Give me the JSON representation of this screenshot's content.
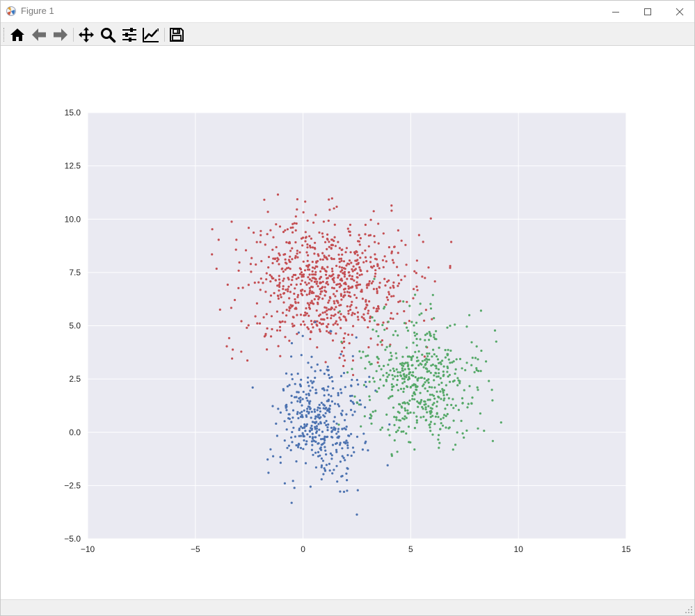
{
  "window": {
    "title": "Figure 1"
  },
  "titlebar_buttons": {
    "minimize_icon": "minimize-icon",
    "maximize_icon": "maximize-icon",
    "close_icon": "close-icon"
  },
  "toolbar": {
    "items": [
      {
        "id": "home",
        "icon": "home-icon"
      },
      {
        "id": "back",
        "icon": "arrow-left-icon"
      },
      {
        "id": "forward",
        "icon": "arrow-right-icon"
      },
      {
        "id": "pan",
        "icon": "move-icon"
      },
      {
        "id": "zoom",
        "icon": "magnifier-icon"
      },
      {
        "id": "subplots",
        "icon": "sliders-icon"
      },
      {
        "id": "edit",
        "icon": "line-chart-icon"
      },
      {
        "id": "save",
        "icon": "floppy-disk-icon"
      }
    ]
  },
  "statusbar": {
    "text": ""
  },
  "colors": {
    "plot_bg": "#eaeaf2",
    "grid": "#ffffff",
    "red": "#c44e52",
    "blue": "#4c72b0",
    "green": "#55a868"
  },
  "chart_data": {
    "type": "scatter",
    "title": "",
    "xlabel": "",
    "ylabel": "",
    "xlim": [
      -10,
      15
    ],
    "ylim": [
      -5,
      15
    ],
    "xticks": [
      "−10",
      "−5",
      "0",
      "5",
      "10",
      "15"
    ],
    "xtick_values": [
      -10,
      -5,
      0,
      5,
      10,
      15
    ],
    "yticks": [
      "−5.0",
      "−2.5",
      "0.0",
      "2.5",
      "5.0",
      "7.5",
      "10.0",
      "12.5",
      "15.0"
    ],
    "ytick_values": [
      -5,
      -2.5,
      0,
      2.5,
      5,
      7.5,
      10,
      12.5,
      15
    ],
    "grid": true,
    "series": [
      {
        "color": "#c44e52",
        "center": [
          1.0,
          7.0
        ],
        "spread": [
          2.0,
          1.5
        ],
        "count": 800
      },
      {
        "color": "#4c72b0",
        "center": [
          0.8,
          0.5
        ],
        "spread": [
          1.0,
          1.5
        ],
        "count": 400
      },
      {
        "color": "#55a868",
        "center": [
          5.5,
          2.3
        ],
        "spread": [
          1.4,
          1.5
        ],
        "count": 500
      }
    ]
  }
}
